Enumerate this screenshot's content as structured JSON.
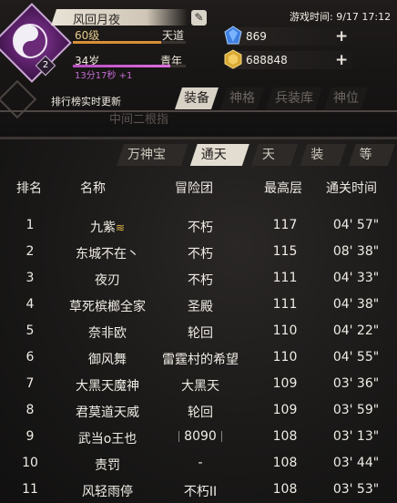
{
  "player": {
    "name": "风回月夜",
    "level": "60级",
    "path": "天道",
    "level_progress": 0.78,
    "age": "34岁",
    "stage": "青年",
    "age_progress": 0.86,
    "timer": "13分17秒 +1",
    "badge": "2"
  },
  "game_time": "游戏时间: 9/17 17:12",
  "currency": {
    "gems": "869",
    "gold": "688848",
    "plus": "+"
  },
  "edit_icon": "✎",
  "notice": "排行榜实时更新",
  "ghost_tab": "中间二根指",
  "top_tabs": [
    "装备",
    "神格",
    "兵装库",
    "神位"
  ],
  "sub_tabs": [
    "万神宝库",
    "通天塔",
    "天梯",
    "装备",
    "等级"
  ],
  "table": {
    "headers": [
      "排名",
      "名称",
      "冒险团",
      "最高层",
      "通关时间"
    ],
    "rows": [
      {
        "rank": "1",
        "name": "九紫",
        "badge": "≋",
        "guild": "不朽",
        "floor": "117",
        "time": "04' 57\""
      },
      {
        "rank": "2",
        "name": "东城不在丶",
        "guild": "不朽",
        "floor": "115",
        "time": "08' 38\""
      },
      {
        "rank": "3",
        "name": "夜刃",
        "guild": "不朽",
        "floor": "111",
        "time": "04' 33\""
      },
      {
        "rank": "4",
        "name": "草死槟榔全家",
        "guild": "圣殿",
        "floor": "111",
        "time": "04' 38\""
      },
      {
        "rank": "5",
        "name": "奈非欧",
        "guild": "轮回",
        "floor": "110",
        "time": "04' 22\""
      },
      {
        "rank": "6",
        "name": "御风舞",
        "guild": "雷霆村的希望",
        "floor": "110",
        "time": "04' 55\""
      },
      {
        "rank": "7",
        "name": "大黑天魔神",
        "guild": "大黑天",
        "floor": "109",
        "time": "03' 36\""
      },
      {
        "rank": "8",
        "name": "君莫道天威",
        "guild": "轮回",
        "floor": "109",
        "time": "03' 59\""
      },
      {
        "rank": "9",
        "name": "武当o王也",
        "guild": "8090",
        "floor": "108",
        "time": "03' 13\""
      },
      {
        "rank": "10",
        "name": "责罚",
        "guild": "-",
        "floor": "108",
        "time": "03' 44\""
      },
      {
        "rank": "11",
        "name": "风轻雨停",
        "guild": "不朽II",
        "floor": "108",
        "time": "03' 53\""
      }
    ]
  },
  "colors": {
    "accent_gold": "#e6c98b",
    "exp_bar": "#d88f35",
    "age_bar": "#c56bd3",
    "active_tab": "#e3ddd1"
  }
}
